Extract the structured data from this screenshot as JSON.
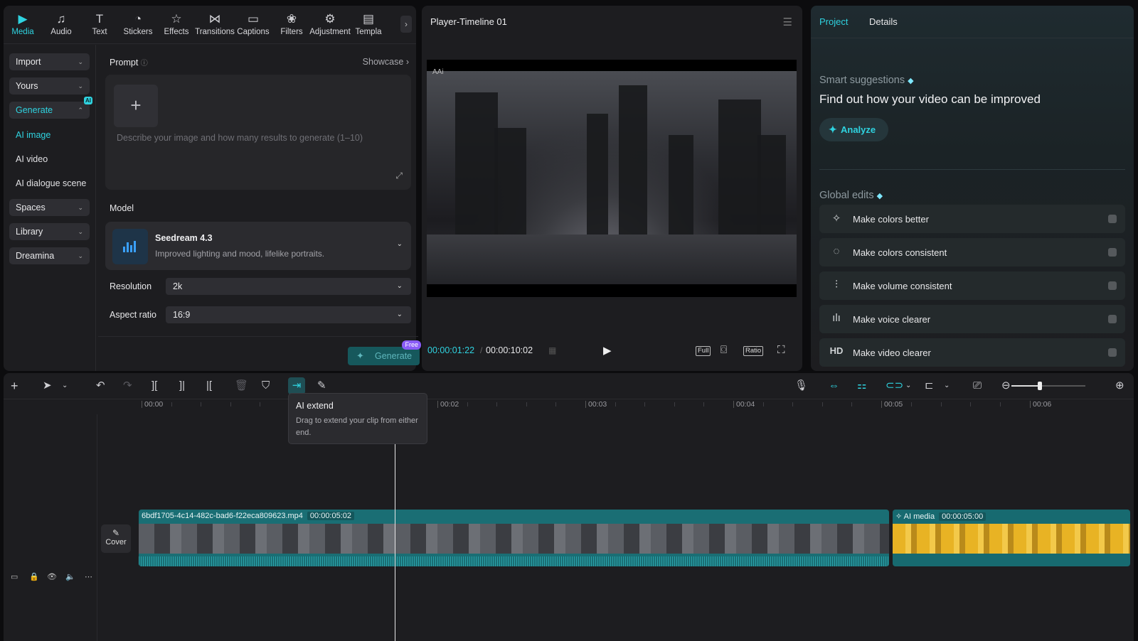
{
  "toolbar": {
    "items": [
      {
        "label": "Media",
        "icon": "media-icon"
      },
      {
        "label": "Audio",
        "icon": "audio-icon"
      },
      {
        "label": "Text",
        "icon": "text-icon"
      },
      {
        "label": "Stickers",
        "icon": "stickers-icon"
      },
      {
        "label": "Effects",
        "icon": "effects-icon"
      },
      {
        "label": "Transitions",
        "icon": "transitions-icon"
      },
      {
        "label": "Captions",
        "icon": "captions-icon"
      },
      {
        "label": "Filters",
        "icon": "filters-icon"
      },
      {
        "label": "Adjustment",
        "icon": "adjustment-icon"
      },
      {
        "label": "Templa",
        "icon": "templates-icon"
      }
    ]
  },
  "sidenav": {
    "import": "Import",
    "yours": "Yours",
    "generate": "Generate",
    "ai_badge": "AI",
    "ai_image": "AI image",
    "ai_video": "AI video",
    "ai_dialogue": "AI dialogue scene",
    "spaces": "Spaces",
    "library": "Library",
    "dreamina": "Dreamina"
  },
  "form": {
    "prompt_label": "Prompt",
    "showcase": "Showcase",
    "placeholder": "Describe your image and how many results to generate (1–10)",
    "model_label": "Model",
    "model_name": "Seedream 4.3",
    "model_desc": "Improved lighting and mood, lifelike portraits.",
    "resolution_label": "Resolution",
    "resolution_value": "2k",
    "aspect_label": "Aspect ratio",
    "aspect_value": "16:9",
    "generate_label": "Generate",
    "free_badge": "Free"
  },
  "player": {
    "title": "Player-Timeline 01",
    "watermark": "AAi",
    "current_time": "00:00:01:22",
    "total_time": "00:00:10:02",
    "full_label": "Full",
    "ratio_label": "Ratio"
  },
  "right": {
    "tab_project": "Project",
    "tab_details": "Details",
    "smart_label": "Smart suggestions",
    "smart_title": "Find out how your video can be improved",
    "analyze": "Analyze",
    "global_label": "Global edits",
    "edits": [
      {
        "label": "Make colors better",
        "icon": "magic-wand-icon"
      },
      {
        "label": "Make colors consistent",
        "icon": "color-wheel-icon"
      },
      {
        "label": "Make volume consistent",
        "icon": "sliders-icon"
      },
      {
        "label": "Make voice clearer",
        "icon": "voice-wave-icon"
      },
      {
        "label": "Make video clearer",
        "icon": "hd-icon"
      }
    ]
  },
  "timeline": {
    "ticks": [
      "00:00",
      "00:02",
      "00:03",
      "00:04",
      "00:05",
      "00:06"
    ],
    "tooltip_title": "AI extend",
    "tooltip_body": "Drag to extend your clip from either end.",
    "cover_label": "Cover",
    "clip1_name": "6bdf1705-4c14-482c-bad6-f22eca809623.mp4",
    "clip1_dur": "00:00:05:02",
    "clip2_name": "AI media",
    "clip2_dur": "00:00:05:00",
    "zoom_level": 0.38
  },
  "colors": {
    "accent": "#2fd3e0",
    "clip": "#1a6e74",
    "panel": "#1d1d20"
  }
}
